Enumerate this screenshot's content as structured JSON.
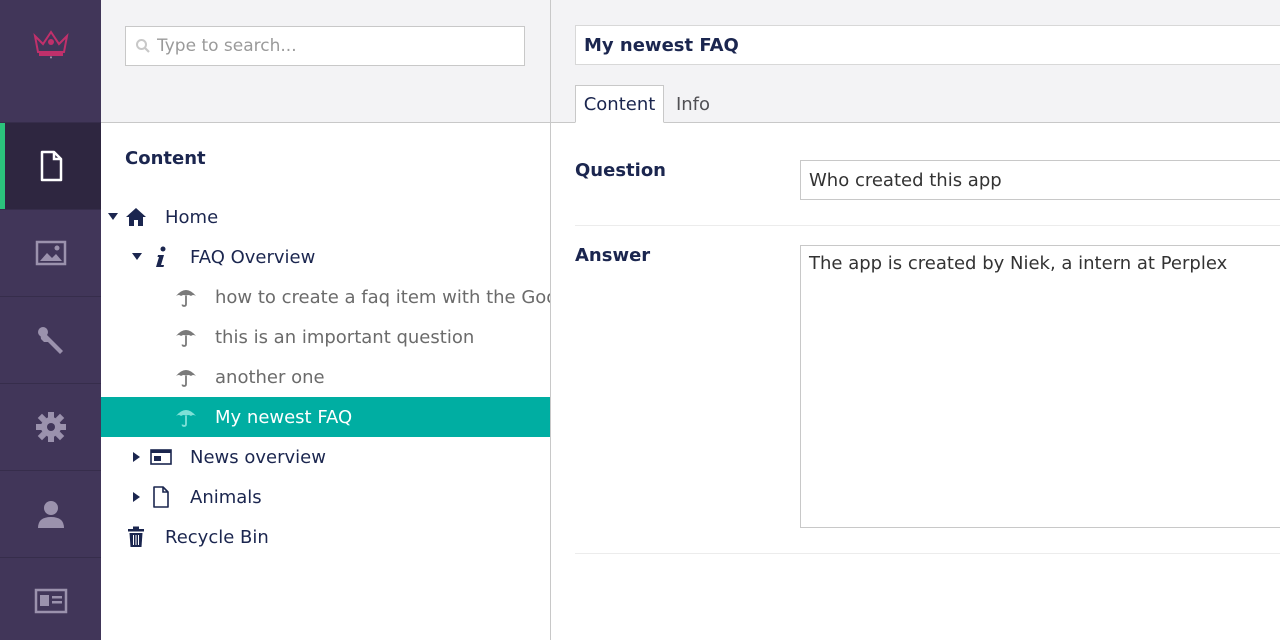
{
  "sections": [
    {
      "name": "content",
      "icon": "document-icon",
      "active": true
    },
    {
      "name": "media",
      "icon": "image-icon",
      "active": false
    },
    {
      "name": "settings",
      "icon": "wrench-icon",
      "active": false
    },
    {
      "name": "developer",
      "icon": "gear-icon",
      "active": false
    },
    {
      "name": "users",
      "icon": "user-icon",
      "active": false
    },
    {
      "name": "members",
      "icon": "id-card-icon",
      "active": false
    }
  ],
  "search": {
    "placeholder": "Type to search..."
  },
  "tree": {
    "title": "Content",
    "items": [
      {
        "label": "Home",
        "icon": "home-icon"
      },
      {
        "label": "FAQ Overview",
        "icon": "info-icon"
      },
      {
        "label": "how to create a faq item with the Google",
        "icon": "umbrella-icon"
      },
      {
        "label": "this is an important question",
        "icon": "umbrella-icon"
      },
      {
        "label": "another one",
        "icon": "umbrella-icon"
      },
      {
        "label": "My newest FAQ",
        "icon": "umbrella-icon"
      },
      {
        "label": "News overview",
        "icon": "window-icon"
      },
      {
        "label": "Animals",
        "icon": "document-icon"
      },
      {
        "label": "Recycle Bin",
        "icon": "trash-icon"
      }
    ]
  },
  "editor": {
    "name": "My newest FAQ",
    "tabs": [
      {
        "label": "Content",
        "active": true
      },
      {
        "label": "Info",
        "active": false
      }
    ],
    "question": {
      "label": "Question",
      "value": "Who created this app"
    },
    "answer": {
      "label": "Answer",
      "value": "The app is created by Niek, a intern at Perplex"
    }
  },
  "colors": {
    "sidebar": "#413659",
    "accent": "#00aea2",
    "active_indicator": "#2bc37c"
  }
}
